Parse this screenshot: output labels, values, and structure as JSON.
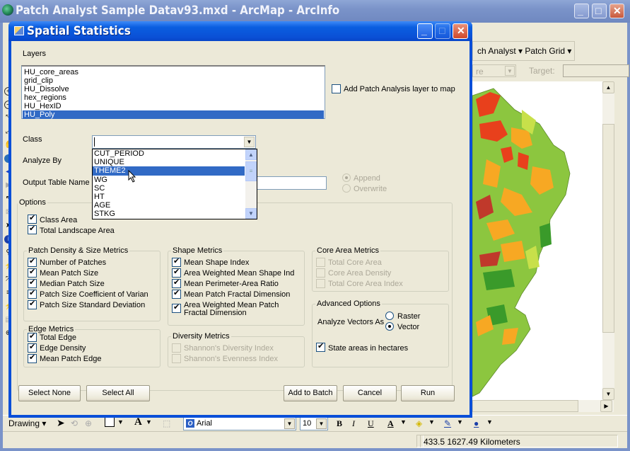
{
  "app": {
    "title": "Patch Analyst Sample Datav93.mxd - ArcMap - ArcInfo",
    "toolbar_menus": [
      "ch Analyst ▾",
      "Patch Grid ▾"
    ],
    "target_label": "Target:",
    "disabled_combo_text": "re"
  },
  "dialog": {
    "title": "Spatial Statistics",
    "layers_label": "Layers",
    "layers": [
      {
        "name": "HU_core_areas",
        "selected": false
      },
      {
        "name": "grid_clip",
        "selected": false
      },
      {
        "name": "HU_Dissolve",
        "selected": false
      },
      {
        "name": "hex_regions",
        "selected": false
      },
      {
        "name": "HU_HexID",
        "selected": false
      },
      {
        "name": "HU_Poly",
        "selected": true
      }
    ],
    "add_layer_label": "Add Patch Analysis layer to map",
    "add_layer_checked": false,
    "class_label": "Class",
    "class_value": "",
    "class_options": [
      {
        "name": "CUT_PERIOD",
        "selected": false
      },
      {
        "name": "UNIQUE",
        "selected": false
      },
      {
        "name": "THEME2",
        "selected": true
      },
      {
        "name": "WG",
        "selected": false
      },
      {
        "name": "SC",
        "selected": false
      },
      {
        "name": "HT",
        "selected": false
      },
      {
        "name": "AGE",
        "selected": false
      },
      {
        "name": "STKG",
        "selected": false
      }
    ],
    "analyze_by_label": "Analyze By",
    "output_table_label": "Output Table Name",
    "output_table_value": "",
    "output_mode": {
      "append_label": "Append",
      "overwrite_label": "Overwrite",
      "selected": "Append"
    },
    "options": {
      "title": "Options",
      "class_area": {
        "label": "Class Area",
        "checked": true
      },
      "total_landscape_area": {
        "label": "Total Landscape Area",
        "checked": true
      }
    },
    "patch_density": {
      "title": "Patch Density & Size Metrics",
      "items": [
        {
          "label": "Number of Patches",
          "checked": true
        },
        {
          "label": "Mean Patch Size",
          "checked": true
        },
        {
          "label": "Median Patch Size",
          "checked": true
        },
        {
          "label": "Patch  Size  Coefficient  of Varian",
          "checked": true
        },
        {
          "label": "Patch Size Standard Deviation",
          "checked": true
        }
      ]
    },
    "shape_metrics": {
      "title": "Shape Metrics",
      "items": [
        {
          "label": "Mean Shape Index",
          "checked": true
        },
        {
          "label": "Area Weighted  Mean  Shape Ind",
          "checked": true
        },
        {
          "label": "Mean Perimeter-Area Ratio",
          "checked": true
        },
        {
          "label": "Mean Patch Fractal Dimension",
          "checked": true
        }
      ],
      "last_item": {
        "line1": "Area Weighted Mean Patch",
        "line2": "Fractal Dimension",
        "checked": true
      }
    },
    "core_area": {
      "title": "Core Area Metrics",
      "items": [
        {
          "label": "Total Core Area",
          "checked": false
        },
        {
          "label": "Core Area Density",
          "checked": false
        },
        {
          "label": "Total Core Area Index",
          "checked": false
        }
      ]
    },
    "advanced": {
      "title": "Advanced Options",
      "analyze_vectors_label": "Analyze Vectors As",
      "raster_label": "Raster",
      "vector_label": "Vector",
      "selected": "Vector",
      "hectares_label": "State areas in hectares",
      "hectares_checked": true
    },
    "edge_metrics": {
      "title": "Edge Metrics",
      "items": [
        {
          "label": "Total Edge",
          "checked": true
        },
        {
          "label": "Edge Density",
          "checked": true
        },
        {
          "label": "Mean Patch Edge",
          "checked": true
        }
      ]
    },
    "diversity": {
      "title": "Diversity Metrics",
      "items": [
        {
          "label": "Shannon's Diversity Index",
          "checked": false
        },
        {
          "label": "Shannon's Evenness Index",
          "checked": false
        }
      ]
    },
    "buttons": {
      "select_none": "Select None",
      "select_all": "Select All",
      "add_to_batch": "Add to Batch",
      "cancel": "Cancel",
      "run": "Run"
    }
  },
  "drawing_toolbar": {
    "drawing_label": "Drawing ▾",
    "font": "Arial",
    "size": "10",
    "bold": "B",
    "italic": "I",
    "underline": "U"
  },
  "status": {
    "coordinates": "433.5  1627.49 Kilometers"
  },
  "colors": {
    "title_active": "#0a50d6",
    "selection": "#316ac5",
    "dialog_bg": "#ece9d8",
    "map_green": "#8cc63f",
    "map_orange": "#f7a823",
    "map_red": "#e8401c"
  }
}
